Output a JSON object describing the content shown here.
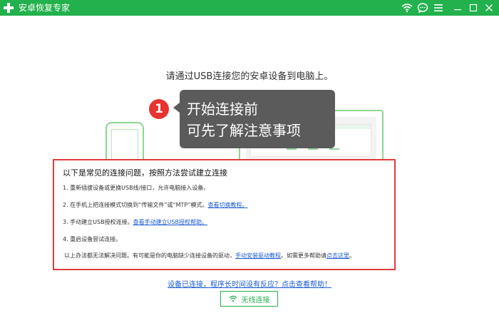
{
  "window": {
    "title": "安卓恢复专家",
    "title_icon": "plus-logo-icon",
    "controls": [
      "wifi-icon",
      "chat-icon",
      "menu-icon",
      "minimize-icon",
      "maximize-icon",
      "close-icon"
    ]
  },
  "main": {
    "heading": "请通过USB连接您的安卓设备到电脑上。"
  },
  "tooltip": {
    "step_number": "1",
    "line1": "开始连接前",
    "line2": "可先了解注意事项"
  },
  "problems": {
    "title": "以下是常见的连接问题，按照方法尝试建立连接",
    "items": [
      {
        "text": "1.  重新插拔设备或更换USB线/接口，允许电脑接入设备。",
        "link": ""
      },
      {
        "text": "2.  在手机上把连接模式切换到“传输文件”或“MTP”模式。",
        "link": "查看切换教程。"
      },
      {
        "text": "3.  手动建立USB授权连接。",
        "link": "查看手动建立USB授权帮助。"
      },
      {
        "text": "4.  重启设备尝试连接。",
        "link": ""
      }
    ],
    "note_prefix": "以上办法都无法解决问题。有可能是你的电脑缺少连接设备的驱动，",
    "note_link1": "手动安装驱动教程",
    "note_middle": "。如需更多帮助请",
    "note_link2": "点击这里",
    "note_suffix": "。"
  },
  "footer": {
    "help_link": "设备已连接，程序长时间没有反应？点击查看帮助！",
    "wireless_button": "无线连接",
    "wireless_icon": "wifi-icon"
  },
  "colors": {
    "brand_green": "#22b14c",
    "alert_red": "#e03b3b",
    "link_blue": "#1a5bd1",
    "tooltip_gray": "#5b5b5b"
  }
}
